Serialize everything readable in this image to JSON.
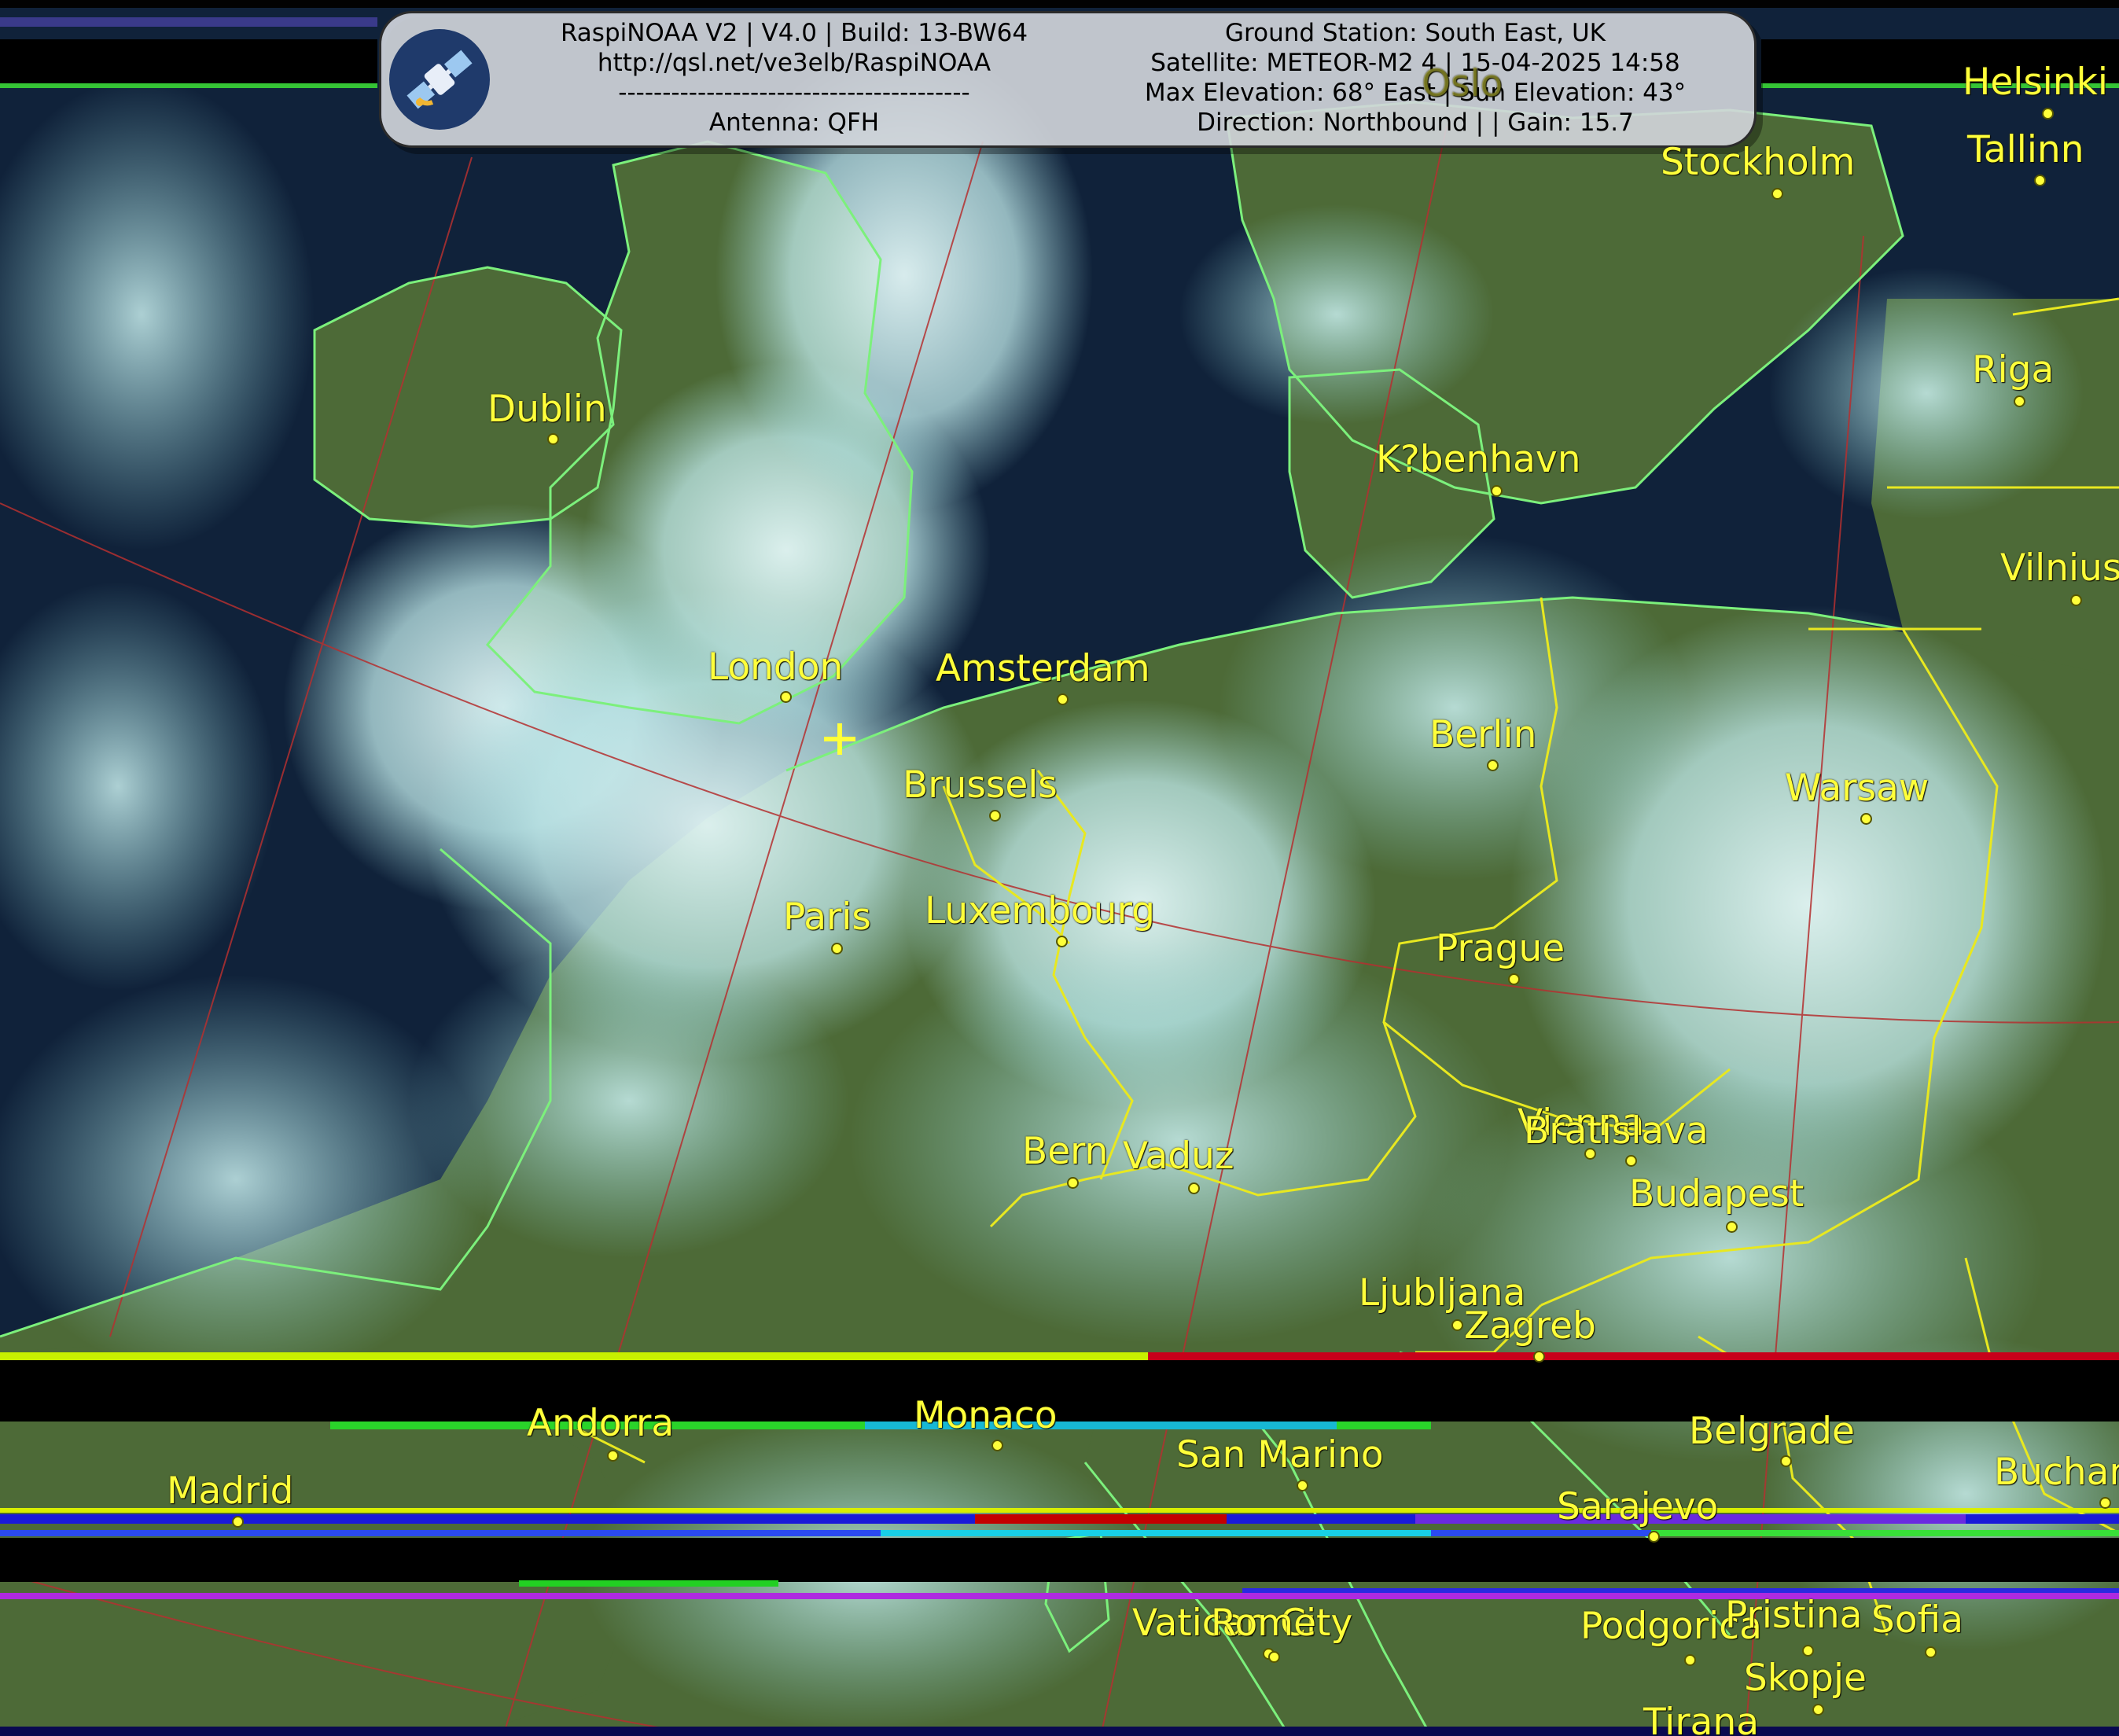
{
  "header": {
    "left_lines": [
      "RaspiNOAA V2 | V4.0 | Build: 13-BW64",
      "http://qsl.net/ve3elb/RaspiNOAA",
      "----------------------------------------",
      "Antenna: QFH"
    ],
    "right_lines": [
      "Ground Station: South East, UK",
      "Satellite: METEOR-M2 4 | 15-04-2025 14:58",
      "Max Elevation: 68° East | Sun Elevation: 43°",
      "Direction: Northbound | | Gain: 15.7"
    ]
  },
  "logo_icon": "satellite-icon",
  "colors": {
    "label": "#ffff3a",
    "coastline": "#7cf07c",
    "border": "#e8e820",
    "graticule": "#b43030",
    "cloud": "#bfe9ea",
    "sea": "#0f1f33",
    "land": "#4e6a36"
  },
  "cities": [
    {
      "name": "Oslo"
    },
    {
      "name": "Helsinki"
    },
    {
      "name": "Tallinn"
    },
    {
      "name": "Stockholm"
    },
    {
      "name": "Riga"
    },
    {
      "name": "Dublin"
    },
    {
      "name": "K?benhavn"
    },
    {
      "name": "Vilnius"
    },
    {
      "name": "London"
    },
    {
      "name": "Amsterdam"
    },
    {
      "name": "Berlin"
    },
    {
      "name": "Brussels"
    },
    {
      "name": "Warsaw"
    },
    {
      "name": "Paris"
    },
    {
      "name": "Luxembourg"
    },
    {
      "name": "Prague"
    },
    {
      "name": "Vienna"
    },
    {
      "name": "Bratislava"
    },
    {
      "name": "Bern"
    },
    {
      "name": "Vaduz"
    },
    {
      "name": "Budapest"
    },
    {
      "name": "Ljubljana"
    },
    {
      "name": "Zagreb"
    },
    {
      "name": "Andorra"
    },
    {
      "name": "Monaco"
    },
    {
      "name": "San Marino"
    },
    {
      "name": "Belgrade"
    },
    {
      "name": "Bucharest"
    },
    {
      "name": "Madrid"
    },
    {
      "name": "Sarajevo"
    },
    {
      "name": "Vatican City"
    },
    {
      "name": "Rome"
    },
    {
      "name": "Podgorica"
    },
    {
      "name": "Pristina"
    },
    {
      "name": "Sofia"
    },
    {
      "name": "Skopje"
    },
    {
      "name": "Tirana"
    }
  ]
}
